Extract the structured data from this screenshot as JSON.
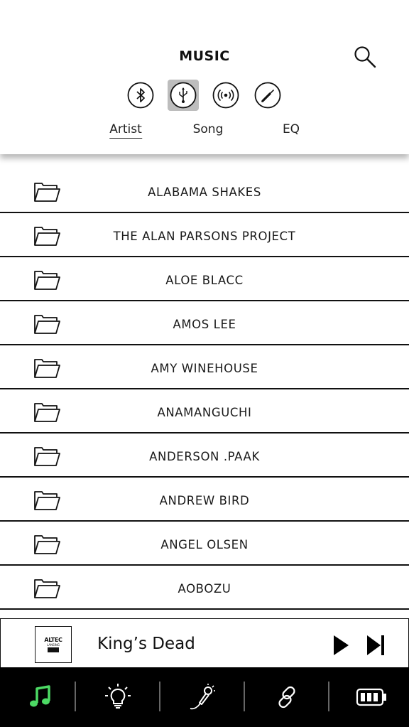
{
  "header": {
    "title": "MUSIC",
    "search_icon": "search-icon"
  },
  "sources": [
    {
      "name": "bluetooth-icon",
      "active": false
    },
    {
      "name": "usb-icon",
      "active": true
    },
    {
      "name": "radio-broadcast-icon",
      "active": false
    },
    {
      "name": "aux-cable-icon",
      "active": false
    }
  ],
  "tabs": [
    {
      "label": "Artist",
      "active": true
    },
    {
      "label": "Song",
      "active": false
    },
    {
      "label": "EQ",
      "active": false
    }
  ],
  "artists": [
    "ALABAMA SHAKES",
    "THE ALAN PARSONS PROJECT",
    "ALOE BLACC",
    "AMOS LEE",
    "AMY WINEHOUSE",
    "ANAMANGUCHI",
    "ANDERSON .PAAK",
    "ANDREW BIRD",
    "ANGEL OLSEN",
    "AOBOZU"
  ],
  "now_playing": {
    "album_logo": "ALTEC",
    "album_logo_sub": "LANSING",
    "track": "King’s Dead"
  },
  "bottom_nav": [
    {
      "name": "music-note-icon",
      "active": true,
      "color": "#4cd964"
    },
    {
      "name": "light-bulb-icon",
      "active": false
    },
    {
      "name": "microphone-icon",
      "active": false
    },
    {
      "name": "link-icon",
      "active": false
    },
    {
      "name": "battery-icon",
      "active": false
    }
  ],
  "colors": {
    "accent": "#4cd964",
    "active_source_bg": "#bdbdbd",
    "nav_bg": "#000000"
  }
}
